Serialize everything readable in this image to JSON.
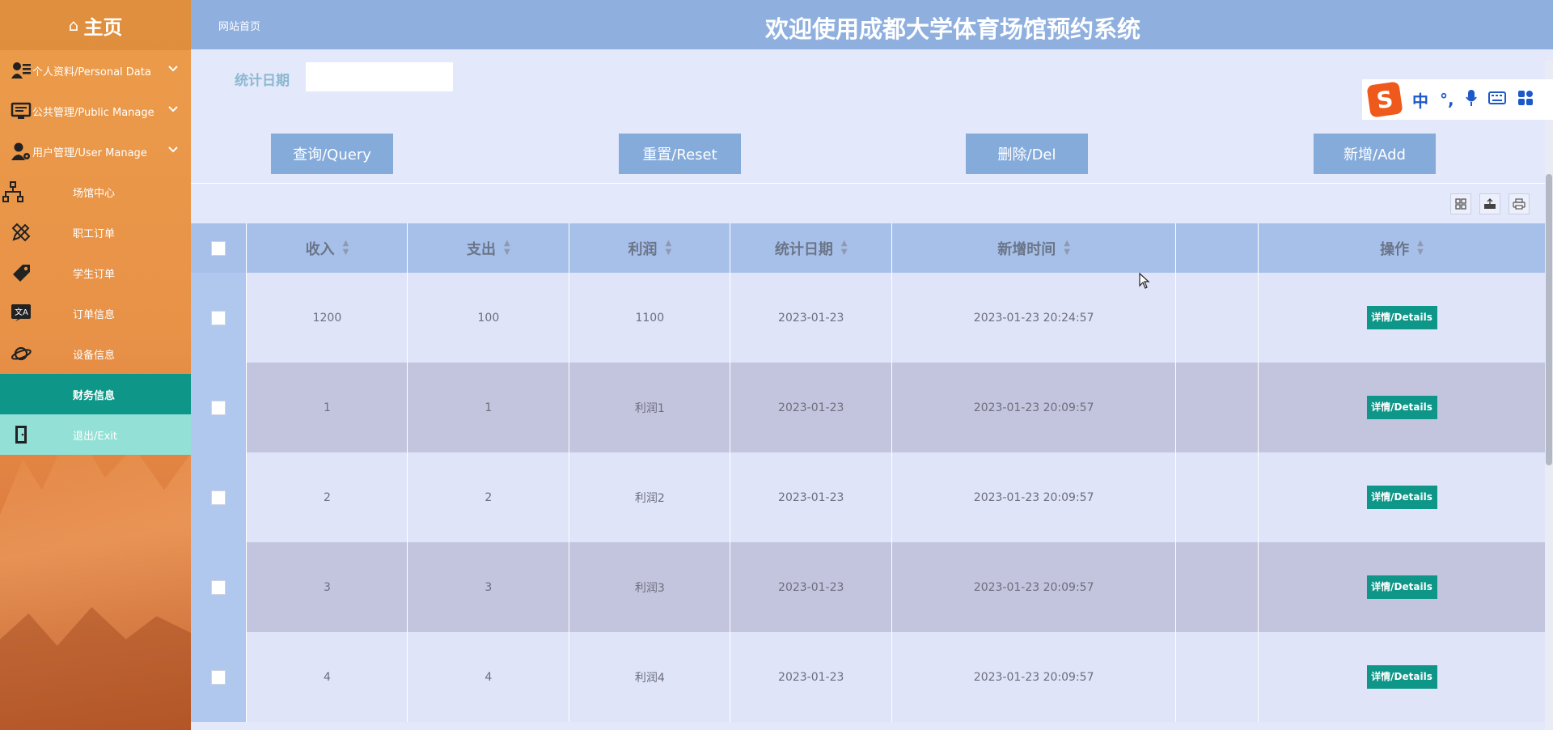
{
  "sidebar": {
    "home_label": "主页",
    "groups": [
      {
        "label": "个人资料/Personal Data",
        "icon": "user-card-icon"
      },
      {
        "label": "公共管理/Public Manage",
        "icon": "monitor-icon"
      },
      {
        "label": "用户管理/User Manage",
        "icon": "user-gear-icon"
      }
    ],
    "items": [
      {
        "label": "场馆中心",
        "icon": "sitemap-icon"
      },
      {
        "label": "职工订单",
        "icon": "pencil-ruler-icon"
      },
      {
        "label": "学生订单",
        "icon": "tag-icon"
      },
      {
        "label": "订单信息",
        "icon": "translate-icon"
      },
      {
        "label": "设备信息",
        "icon": "planet-icon"
      },
      {
        "label": "财务信息",
        "icon": ""
      },
      {
        "label": "退出/Exit",
        "icon": "door-exit-icon"
      }
    ],
    "active_item": "财务信息"
  },
  "header": {
    "breadcrumb": "网站首页",
    "title": "欢迎使用成都大学体育场馆预约系统"
  },
  "filter": {
    "label": "统计日期",
    "value": "",
    "placeholder": ""
  },
  "buttons": {
    "query": "查询/Query",
    "reset": "重置/Reset",
    "delete": "删除/Del",
    "add": "新增/Add"
  },
  "toolbar_icons": [
    "columns-icon",
    "export-icon",
    "print-icon"
  ],
  "table": {
    "columns": [
      "收入",
      "支出",
      "利润",
      "统计日期",
      "新增时间",
      "",
      "操作"
    ],
    "rows": [
      {
        "income": "1200",
        "expense": "100",
        "profit": "1100",
        "date": "2023-01-23",
        "created": "2023-01-23 20:24:57",
        "action": "详情/Details"
      },
      {
        "income": "1",
        "expense": "1",
        "profit": "利润1",
        "date": "2023-01-23",
        "created": "2023-01-23 20:09:57",
        "action": "详情/Details"
      },
      {
        "income": "2",
        "expense": "2",
        "profit": "利润2",
        "date": "2023-01-23",
        "created": "2023-01-23 20:09:57",
        "action": "详情/Details"
      },
      {
        "income": "3",
        "expense": "3",
        "profit": "利润3",
        "date": "2023-01-23",
        "created": "2023-01-23 20:09:57",
        "action": "详情/Details"
      },
      {
        "income": "4",
        "expense": "4",
        "profit": "利润4",
        "date": "2023-01-23",
        "created": "2023-01-23 20:09:57",
        "action": "详情/Details"
      }
    ]
  },
  "ime": {
    "logo": "S",
    "mode": "中",
    "punct": "°,",
    "icons": [
      "microphone-icon",
      "keyboard-icon",
      "grid-menu-icon"
    ]
  },
  "colors": {
    "sidebar": "#e89248",
    "header": "#8fb0df",
    "background": "#e3e8fb",
    "button": "#85abdb",
    "active": "#0e9688",
    "details_button": "#0e9688"
  }
}
